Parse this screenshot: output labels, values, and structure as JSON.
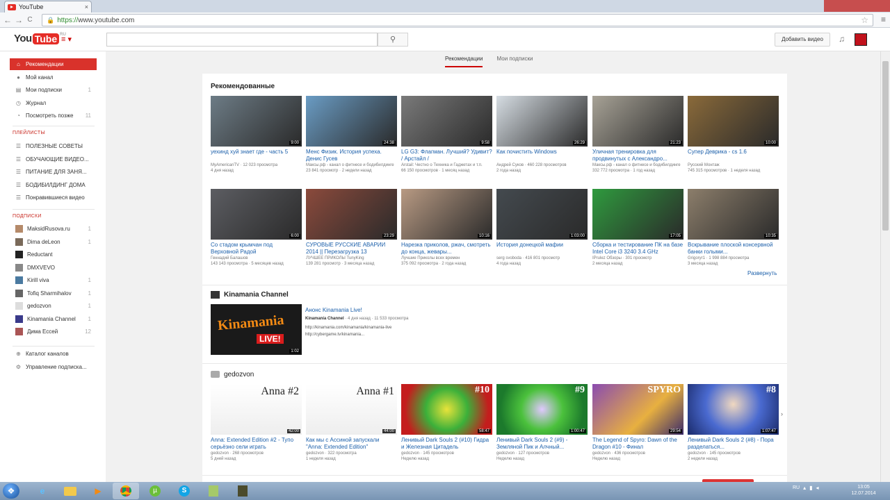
{
  "browser": {
    "tab_title": "YouTube",
    "tab_close": "×",
    "url_scheme": "https://",
    "url_host": "www.youtube.com",
    "back": "←",
    "forward": "→",
    "reload": "C",
    "star": "☆",
    "menu": "≡"
  },
  "masthead": {
    "logo_you": "You",
    "logo_tube": "Tube",
    "logo_region": "RU",
    "guide_icon": "≡ ▾",
    "search_placeholder": "",
    "search_icon": "🔍",
    "upload_label": "Добавить видео",
    "bell": "🔔"
  },
  "guide": {
    "items": [
      {
        "label": "Рекомендации",
        "icon": "⌂",
        "active": true
      },
      {
        "label": "Мой канал",
        "icon": "●"
      },
      {
        "label": "Мои подписки",
        "icon": "▤",
        "arrow": "1"
      },
      {
        "label": "Журнал",
        "icon": "◷"
      },
      {
        "label": "Посмотреть позже",
        "icon": "◔",
        "arrow": "11"
      }
    ],
    "playlists_header": "ПЛЕЙЛИСТЫ",
    "playlists": [
      "ПОЛЕЗНЫЕ СОВЕТЫ",
      "ОБУЧАЮЩИЕ ВИДЕО...",
      "ПИТАНИЕ ДЛЯ ЗАНЯ...",
      "БОДИБИЛДИНГ ДОМА",
      "Понравившиеся видео"
    ],
    "subs_header": "ПОДПИСКИ",
    "subscriptions": [
      {
        "label": "MaksidRusova.ru",
        "arrow": "1"
      },
      {
        "label": "Dima deLeon",
        "arrow": "1"
      },
      {
        "label": "Reductant",
        "arrow": ""
      },
      {
        "label": "DMXVEVO",
        "arrow": ""
      },
      {
        "label": "Kirill viva",
        "arrow": "1"
      },
      {
        "label": "Tofiq Sharmihalov",
        "arrow": "1"
      },
      {
        "label": "gedozvon",
        "arrow": "1"
      },
      {
        "label": "Kinamania Channel",
        "arrow": "1"
      },
      {
        "label": "Дима Ессей",
        "arrow": "12"
      }
    ],
    "bottom": [
      {
        "label": "Каталог каналов",
        "icon": "⊕"
      },
      {
        "label": "Управление подписка...",
        "icon": "⚙"
      }
    ]
  },
  "feed_tabs": [
    "Рекомендации",
    "Мои подписки"
  ],
  "recommended": {
    "title": "Рекомендованные",
    "expand": "Развернуть",
    "videos": [
      {
        "title": "уехинд хуй знает где - часть 5",
        "channel": "MyAmericanTV · 12 023 просмотра",
        "age": "4 дня назад",
        "dur": "9:00",
        "bg": "#6d7c86"
      },
      {
        "title": "Менс Физик. История успеха. Денис Гусев",
        "channel": "Максы.рф - канал о фитнесе и бодибилдинге",
        "age": "23 841 просмотр · 2 недели назад",
        "dur": "24:38",
        "bg": "#6a9cc4"
      },
      {
        "title": "LG G3: Флагман. Лучший? Удивит? / Арстайл /",
        "channel": "Arstail: Честно о Техника и Гаджетах и т.п.",
        "age": "66 150 просмотров · 1 месяц назад",
        "dur": "9:58",
        "bg": "#7a7a7a"
      },
      {
        "title": "Как почистить Windows",
        "channel": "Андрей Суков · 460 228 просмотров",
        "age": "2 года назад",
        "dur": "26:29",
        "bg": "#d6dde3"
      },
      {
        "title": "Уличная тренировка для продвинутых с Александро...",
        "channel": "Максы.рф - канал о фитнесе и бодибилдинге",
        "age": "332 772 просмотра · 1 год назад",
        "dur": "21:23",
        "bg": "#a7a296"
      },
      {
        "title": "Супер Деврика - cs 1.6",
        "channel": "Русский Монтаж",
        "age": "745 315 просмотров · 1 неделя назад",
        "dur": "10:00",
        "bg": "#8a6a3a"
      },
      {
        "title": "Со стадом крымчан под Верховной Радой",
        "channel": "Геннадий Балашов",
        "age": "143 143 просмотра · 5 месяцев назад",
        "dur": "6:00",
        "bg": "#5c5d62"
      },
      {
        "title": "СУРОВЫЕ РУССКИЕ АВАРИИ 2014 || Перезагрузка 13",
        "channel": "ЛУЧШЕЕ ПРИКОЛЫ TunyKing",
        "age": "139 281 просмотр · 3 месяца назад",
        "dur": "23:29",
        "bg": "#8b4a3c"
      },
      {
        "title": "Нарезка приколов, ржач, смотреть до конца, жевары...",
        "channel": "Лучшие Приколы всех времен",
        "age": "375 092 просмотра · 2 года назад",
        "dur": "10:16",
        "bg": "#b89a83"
      },
      {
        "title": "История донецкой мафии",
        "channel": "serg svoboda · 416 801 просмотр",
        "age": "4 года назад",
        "dur": "1:03:00",
        "bg": "#444a4f"
      },
      {
        "title": "Сборка и тестирование ПК на базе Intel Core i3 3240 3.4 GHz",
        "channel": "IPrulez Обзоры · 301 просмотр",
        "age": "2 месяца назад",
        "dur": "17:05",
        "bg": "#2f9a3e"
      },
      {
        "title": "Вскрывание плоской консервной банки голыми...",
        "channel": "Grigoryr1 · 1 998 884 просмотра",
        "age": "3 месяца назад",
        "dur": "10:35",
        "bg": "#8c7e6b"
      }
    ]
  },
  "kinamania": {
    "title": "Kinamania Channel",
    "video_title": "Анонс Kinamania Live!",
    "channel": "Kinamania Channel",
    "meta": " · 4 дня назад · 11 533 просмотра",
    "desc1": "http://kinamania.com/kinamania/kinamania-live",
    "desc2": "http://cybergame.tv/kinamania...",
    "dur": "1:02",
    "thumb_text": "Kinamania",
    "thumb_live": "LIVE!"
  },
  "gedozvon": {
    "title": "gedozvon",
    "videos": [
      {
        "title": "Anna: Extended Edition #2 - Тупо серьёзно сели играть",
        "channel": "gedozvon · 268 просмотров",
        "age": "5 дней назад",
        "dur": "42:00",
        "thumb": "Anna #2"
      },
      {
        "title": "Как мы с Ассиной запускали \"Anna: Extended Edition\"",
        "channel": "gedozvon · 322 просмотра",
        "age": "1 неделя назад",
        "dur": "44:00",
        "thumb": "Anna #1"
      },
      {
        "title": "Ленивый Dark Souls 2 (#10) Гидра и Железная Цитадель",
        "channel": "gedozvon · 145 просмотров",
        "age": "Неделю назад",
        "dur": "58:47",
        "thumb": "#10"
      },
      {
        "title": "Ленивый Dark Souls 2 (#9) - Земляной Пик и Алчный...",
        "channel": "gedozvon · 127 просмотров",
        "age": "Неделю назад",
        "dur": "1:00:47",
        "thumb": "#9"
      },
      {
        "title": "The Legend of Spyro: Dawn of the Dragon #10 - Финал",
        "channel": "gedozvon · 436 просмотров",
        "age": "Неделю назад",
        "dur": "29:54",
        "thumb": "SPYRO"
      },
      {
        "title": "Ленивый Dark Souls 2 (#8) - Пора разделаться...",
        "channel": "gedozvon · 145 просмотров",
        "age": "2 недели назад",
        "dur": "1:07:47",
        "thumb": "#8"
      }
    ]
  },
  "taskbar": {
    "start": "❖",
    "lang": "RU",
    "time": "13:05",
    "date": "12.07.2014"
  },
  "colors": {
    "brand": "#e52d27",
    "link": "#1b5faa"
  }
}
